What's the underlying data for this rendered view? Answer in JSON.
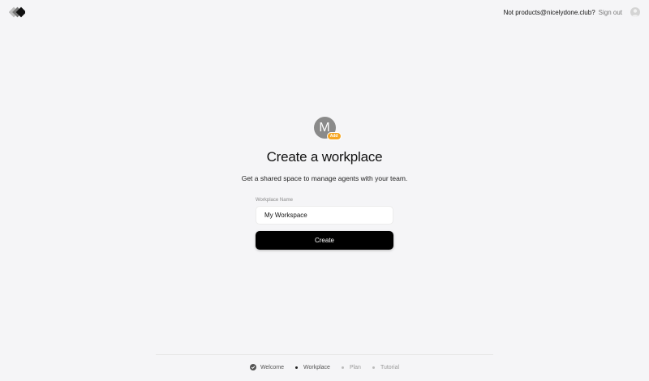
{
  "header": {
    "user_prompt": "Not products@nicelydone.club?",
    "signout_label": "Sign out"
  },
  "workspace_avatar": {
    "initial": "M",
    "add_label": "Add",
    "avatar_color": "#8a8a8a",
    "badge_color": "#f5a623"
  },
  "main": {
    "title": "Create a workplace",
    "subtitle": "Get a shared space to manage agents with your team.",
    "field_label": "Workplace Name",
    "field_value": "My Workspace",
    "create_label": "Create"
  },
  "steps": [
    {
      "label": "Welcome",
      "state": "done",
      "icon": "check-circle-icon"
    },
    {
      "label": "Workplace",
      "state": "current"
    },
    {
      "label": "Plan",
      "state": "upcoming"
    },
    {
      "label": "Tutorial",
      "state": "upcoming"
    }
  ]
}
